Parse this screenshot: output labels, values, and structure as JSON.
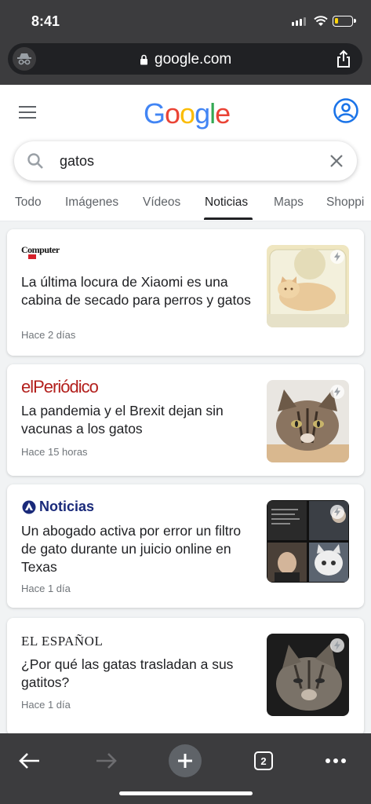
{
  "status_bar": {
    "time": "8:41",
    "battery_level": 0.2,
    "battery_color": "#ffd60a",
    "icons": [
      "signal-icon",
      "wifi-icon",
      "battery-icon"
    ]
  },
  "address_bar": {
    "url": "google.com",
    "icons": [
      "incognito-icon",
      "lock-icon",
      "share-icon"
    ]
  },
  "google_header": {
    "logo": "Google",
    "icons": [
      "hamburger-menu-icon",
      "account-icon"
    ]
  },
  "search": {
    "query": "gatos",
    "icons": [
      "search-icon",
      "clear-icon"
    ]
  },
  "tabs": [
    {
      "label": "Todo",
      "active": false
    },
    {
      "label": "Imágenes",
      "active": false
    },
    {
      "label": "Vídeos",
      "active": false
    },
    {
      "label": "Noticias",
      "active": true
    },
    {
      "label": "Maps",
      "active": false
    },
    {
      "label": "Shoppi",
      "active": false
    }
  ],
  "news": [
    {
      "source": "Computer",
      "title": "La última locura de Xiaomi es una cabina de secado para perros y gatos",
      "time": "Hace 2 días",
      "thumbnail": "cat-in-dryer-cabin-image"
    },
    {
      "source": "elPeriódico",
      "title": "La pandemia y el Brexit dejan sin vacunas a los gatos",
      "time": "Hace 15 horas",
      "thumbnail": "tabby-cat-image"
    },
    {
      "source": "Noticias",
      "title": "Un abogado activa por error un filtro de gato durante un juicio online en Texas",
      "time": "Hace 1 día",
      "thumbnail": "zoom-call-cat-filter-image"
    },
    {
      "source": "EL ESPAÑOL",
      "title": "¿Por qué las gatas trasladan a sus gatitos?",
      "time": "Hace 1 día",
      "thumbnail": "kitten-image"
    }
  ],
  "toolbar": {
    "tab_count": "2",
    "icons": [
      "back-arrow-icon",
      "forward-arrow-icon",
      "new-tab-plus-icon",
      "tab-switcher-icon",
      "more-menu-icon"
    ]
  },
  "colors": {
    "chrome_dark": "#3c3c3e",
    "google_blue": "#4285F4",
    "google_red": "#EA4335",
    "google_yellow": "#FBBC05",
    "google_green": "#34A853",
    "elperiodico_red": "#b3201d",
    "noticias_blue": "#1a2a7a"
  }
}
